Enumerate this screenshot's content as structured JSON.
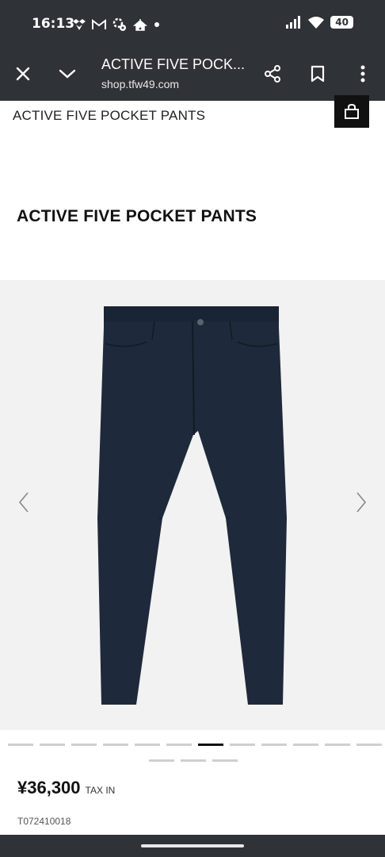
{
  "status_bar": {
    "time": "16:13",
    "battery": "40",
    "icons": [
      "dropbox-icon",
      "gmail-icon",
      "settings-icon",
      "tent-icon",
      "dot-icon",
      "signal-icon",
      "wifi-icon",
      "battery-icon"
    ]
  },
  "browser": {
    "title": "ACTIVE FIVE POCK...",
    "url": "shop.tfw49.com"
  },
  "page": {
    "sticky_title": "ACTIVE FIVE POCKET PANTS",
    "product_title": "ACTIVE FIVE POCKET PANTS",
    "price": "¥36,300",
    "tax_label": "TAX IN",
    "product_code": "T072410018"
  },
  "gallery": {
    "total_images": 15,
    "active_index": 6
  },
  "colors": {
    "chrome": "#2f3237",
    "pants": "#1e2a3b",
    "gallery_bg": "#f2f2f2",
    "active_dot": "#111111"
  }
}
